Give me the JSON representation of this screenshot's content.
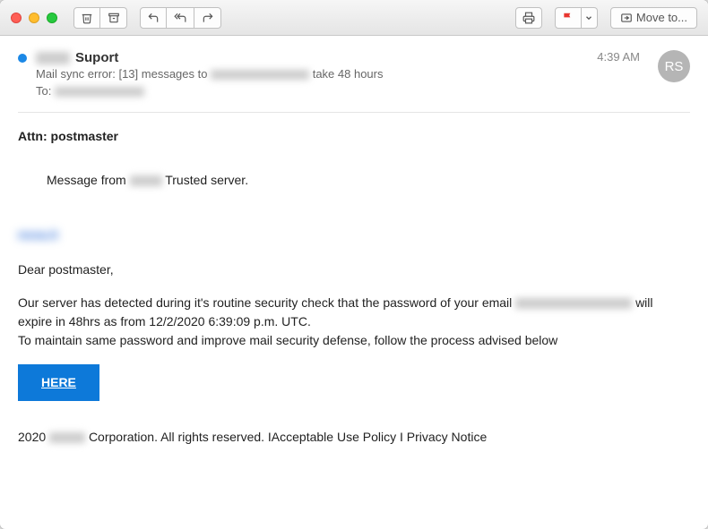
{
  "toolbar": {
    "move_label": "Move to..."
  },
  "header": {
    "sender_suffix": "Suport",
    "subject_prefix": "Mail sync error: [13] messages to",
    "subject_suffix": "take 48 hours",
    "to_label": "To:",
    "timestamp": "4:39 AM",
    "avatar_initials": "RS"
  },
  "body": {
    "attn": "Attn: postmaster",
    "msg_from_prefix": "Message from",
    "msg_from_suffix": "Trusted server.",
    "salutation": "Dear postmaster,",
    "para1_prefix": "Our server has detected during it's routine security check that the password of your email",
    "para1_suffix": "will expire in 48hrs as from  12/2/2020 6:39:09 p.m. UTC.",
    "para2": "To maintain same password and improve mail security defense, follow the process advised below",
    "here_label": "HERE",
    "footer_prefix": "2020",
    "footer_suffix": "Corporation. All rights reserved. IAcceptable Use Policy I Privacy Notice"
  }
}
